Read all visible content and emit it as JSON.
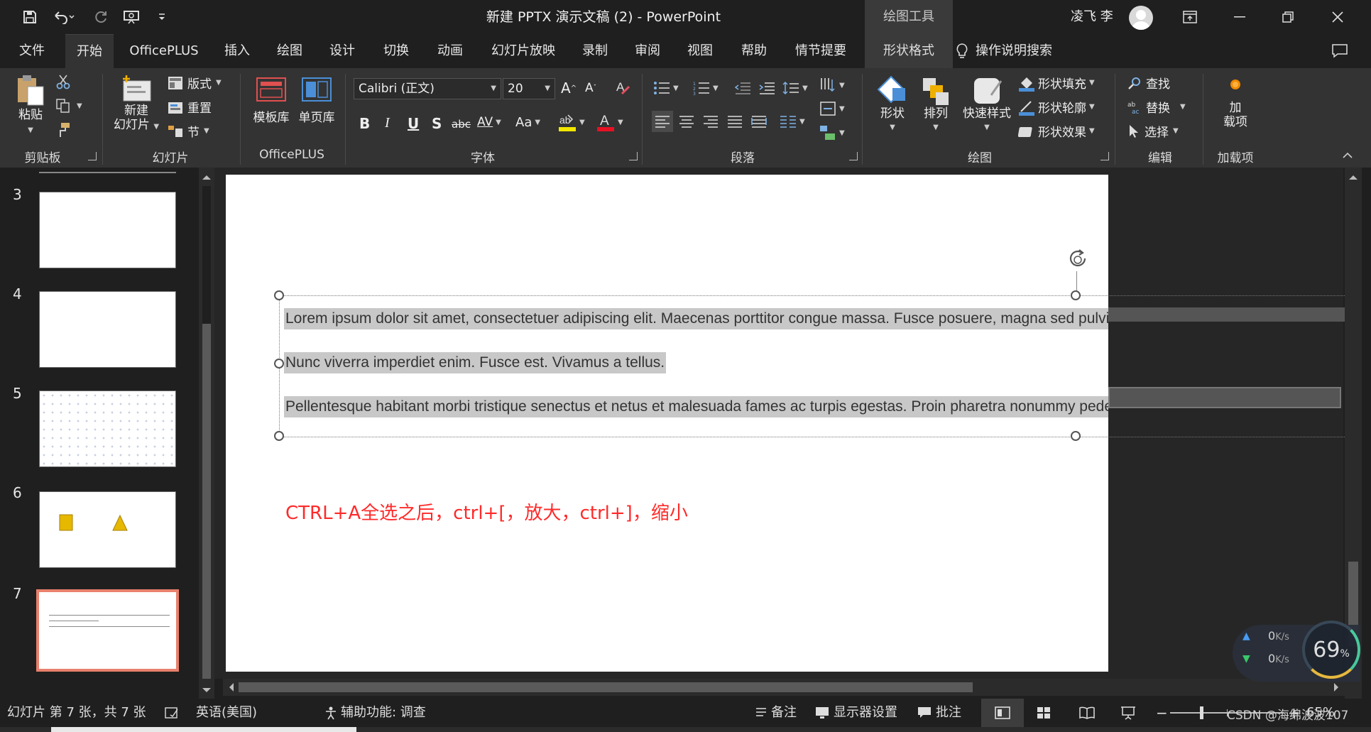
{
  "app": {
    "title": "新建 PPTX 演示文稿 (2)  -  PowerPoint",
    "context_tools": "绘图工具",
    "user_name": "凌飞 李"
  },
  "tabs": [
    "文件",
    "开始",
    "OfficePLUS",
    "插入",
    "绘图",
    "设计",
    "切换",
    "动画",
    "幻灯片放映",
    "录制",
    "审阅",
    "视图",
    "帮助",
    "情节提要",
    "形状格式"
  ],
  "active_tab": "开始",
  "tell_me": "操作说明搜索",
  "ribbon": {
    "clipboard": {
      "paste": "粘贴",
      "label": "剪贴板"
    },
    "slides": {
      "new_slide_line1": "新建",
      "new_slide_line2": "幻灯片",
      "layout": "版式",
      "reset": "重置",
      "section": "节",
      "label": "幻灯片"
    },
    "officeplus": {
      "template_lib": "模板库",
      "single_page_lib": "单页库",
      "label": "OfficePLUS"
    },
    "font": {
      "family": "Calibri (正文)",
      "size": "20",
      "bold": "B",
      "italic": "I",
      "underline": "U",
      "shadow": "S",
      "strikethrough": "abc",
      "spacing": "AV",
      "case": "Aa",
      "label": "字体"
    },
    "paragraph": {
      "label": "段落"
    },
    "drawing": {
      "shapes": "形状",
      "arrange": "排列",
      "quick_styles": "快速样式",
      "shape_fill": "形状填充",
      "shape_outline": "形状轮廓",
      "shape_effects": "形状效果",
      "label": "绘图"
    },
    "editing": {
      "find": "查找",
      "replace": "替换",
      "select": "选择",
      "label": "编辑"
    },
    "addins": {
      "addins_line1": "加",
      "addins_line2": "载项",
      "label": "加载项"
    }
  },
  "thumbnails": [
    {
      "number": "3",
      "content": "blank"
    },
    {
      "number": "4",
      "content": "blank"
    },
    {
      "number": "5",
      "content": "dots"
    },
    {
      "number": "6",
      "content": "shapes"
    },
    {
      "number": "7",
      "content": "text",
      "selected": true
    }
  ],
  "slide": {
    "paragraphs": [
      "Lorem ipsum dolor sit amet, consectetuer adipiscing elit. Maecenas porttitor congue massa. Fusce posuere, magna sed pulvinar ultricies, puru",
      "Nunc viverra imperdiet enim. Fusce est. Vivamus a tellus.",
      "Pellentesque habitant morbi tristique senectus et netus et malesuada fames ac turpis egestas. Proin pharetra nonummy pede. Mauris et orci."
    ],
    "note_text": "CTRL+A全选之后，ctrl+[，放大，ctrl+]，缩小",
    "note_color": "#ff2a2a"
  },
  "network_widget": {
    "upload": "0",
    "download": "0",
    "unit": "K/s",
    "percent": "69",
    "percent_sign": "%"
  },
  "statusbar": {
    "slide_info": "幻灯片 第 7 张，共 7 张",
    "language": "英语(美国)",
    "accessibility": "辅助功能: 调查",
    "notes": "备注",
    "display_settings": "显示器设置",
    "comments": "批注",
    "zoom": "65%",
    "watermark": "CSDN @海绵波波107"
  },
  "colors": {
    "accent_selected_thumb": "#e8806c",
    "fill_yellow": "#f2e600",
    "font_red": "#e81123"
  }
}
